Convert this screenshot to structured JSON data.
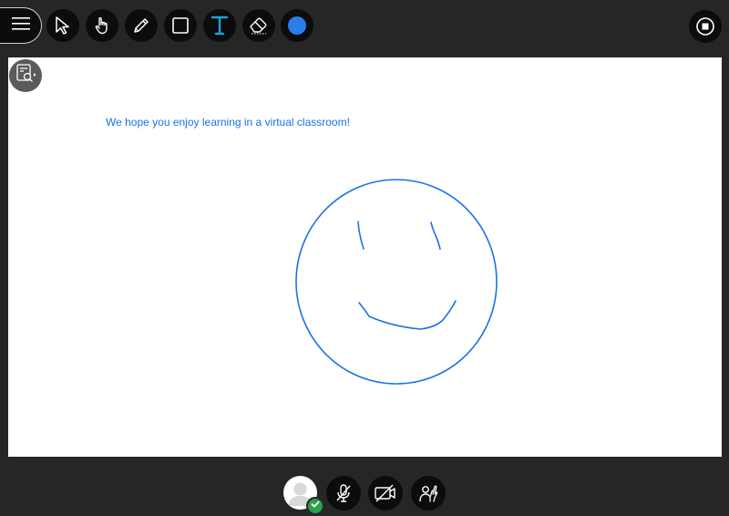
{
  "toolbar": {
    "menu_icon": "hamburger-icon",
    "tools": [
      {
        "name": "select-tool",
        "icon": "arrow-pointer-icon"
      },
      {
        "name": "pointer-tool",
        "icon": "hand-pointer-icon"
      },
      {
        "name": "pen-tool",
        "icon": "pencil-icon"
      },
      {
        "name": "shape-tool",
        "icon": "square-icon"
      },
      {
        "name": "text-tool",
        "icon": "text-t-icon",
        "color": "#1aa3d9"
      },
      {
        "name": "eraser-tool",
        "icon": "eraser-icon"
      },
      {
        "name": "color-picker",
        "icon": "color-swatch-icon",
        "color": "#2b7de9"
      }
    ],
    "stop_icon": "stop-share-icon"
  },
  "canvas": {
    "text": "We hope you enjoy learning in a virtual classroom!",
    "text_color": "#1a73e8",
    "drawing": "smiley-face",
    "stroke_color": "#1a73e8",
    "tools_button_icon": "canvas-tools-icon"
  },
  "bottom": {
    "avatar_icon": "user-avatar-icon",
    "status": "connected",
    "status_color": "#2e9f4a",
    "controls": [
      {
        "name": "microphone-button",
        "icon": "mic-off-icon"
      },
      {
        "name": "camera-button",
        "icon": "camera-off-icon"
      },
      {
        "name": "raise-hand-button",
        "icon": "raise-hand-icon"
      }
    ]
  }
}
